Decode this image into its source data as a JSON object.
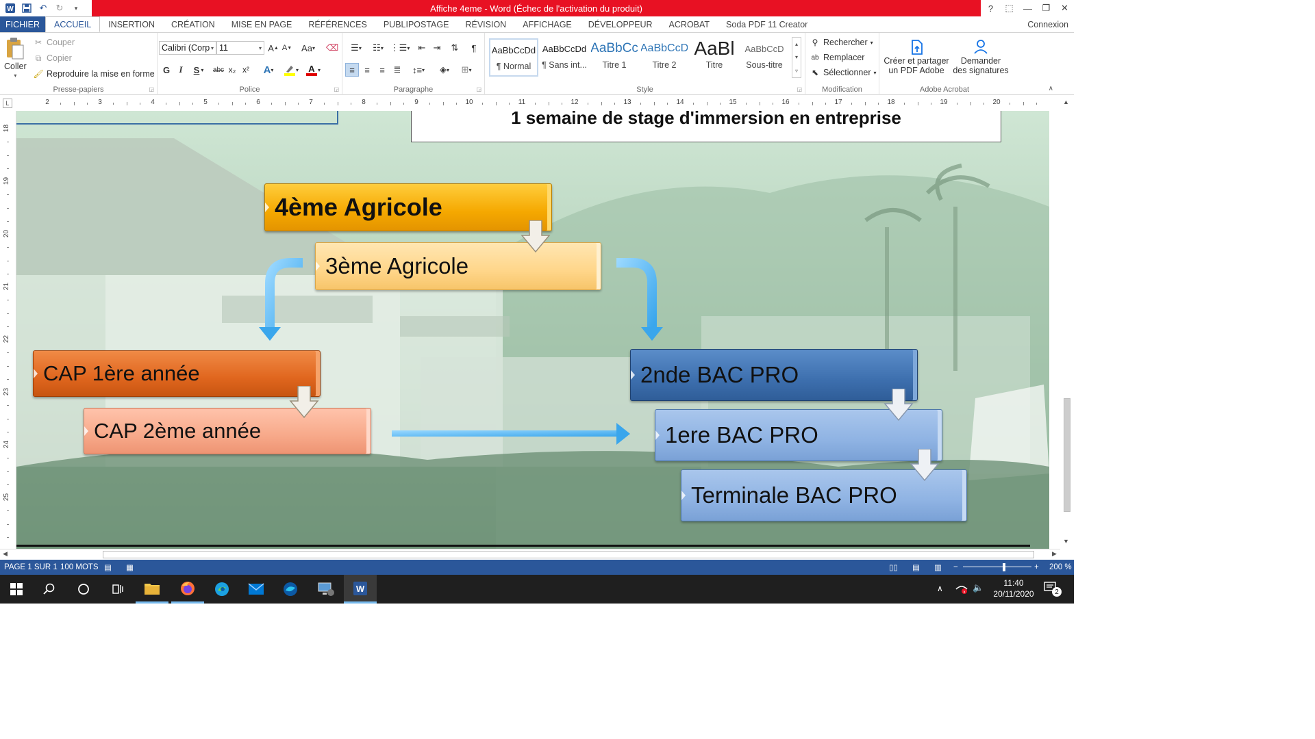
{
  "titlebar": {
    "title": "Affiche 4eme -  Word (Échec de l'activation du produit)",
    "help": "?",
    "ribbon_display": "⬚",
    "minimize": "—",
    "restore": "❐",
    "close": "✕"
  },
  "tabs": [
    {
      "label": "FICHIER"
    },
    {
      "label": "ACCUEIL"
    },
    {
      "label": "INSERTION"
    },
    {
      "label": "CRÉATION"
    },
    {
      "label": "MISE EN PAGE"
    },
    {
      "label": "RÉFÉRENCES"
    },
    {
      "label": "PUBLIPOSTAGE"
    },
    {
      "label": "RÉVISION"
    },
    {
      "label": "AFFICHAGE"
    },
    {
      "label": "DÉVELOPPEUR"
    },
    {
      "label": "ACROBAT"
    },
    {
      "label": "Soda PDF 11 Creator"
    }
  ],
  "connexion": "Connexion",
  "clipboard": {
    "paste": "Coller",
    "cut": "Couper",
    "copy": "Copier",
    "format_painter": "Reproduire la mise en forme",
    "label": "Presse-papiers"
  },
  "font": {
    "name": "Calibri (Corp",
    "size": "11",
    "label": "Police",
    "bold": "G",
    "italic": "I",
    "underline": "S",
    "strike": "abc",
    "sub": "x₂",
    "sup": "x²",
    "grow": "A",
    "shrink": "A",
    "case": "Aa"
  },
  "paragraph": {
    "label": "Paragraphe",
    "pilcrow": "¶"
  },
  "styles": {
    "label": "Style",
    "items": [
      {
        "preview": "AaBbCcDd",
        "name": "¶ Normal"
      },
      {
        "preview": "AaBbCcDd",
        "name": "¶ Sans int..."
      },
      {
        "preview": "AaBbCc",
        "name": "Titre 1"
      },
      {
        "preview": "AaBbCcD",
        "name": "Titre 2"
      },
      {
        "preview": "AaBl",
        "name": "Titre"
      },
      {
        "preview": "AaBbCcD",
        "name": "Sous-titre"
      }
    ]
  },
  "editing": {
    "label": "Modification",
    "find": "Rechercher",
    "replace": "Remplacer",
    "select": "Sélectionner"
  },
  "acrobat": {
    "label": "Adobe Acrobat",
    "create_line1": "Créer et partager",
    "create_line2": "un PDF Adobe",
    "sign_line1": "Demander",
    "sign_line2": "des signatures"
  },
  "ruler": {
    "h": [
      "2",
      "3",
      "4",
      "5",
      "6",
      "7",
      "8",
      "9",
      "10",
      "11",
      "12",
      "13",
      "14",
      "15",
      "16",
      "17",
      "18",
      "19",
      "20"
    ],
    "v": [
      "18",
      "19",
      "20",
      "21",
      "22",
      "23",
      "24",
      "25"
    ]
  },
  "document": {
    "banner": "1 semaine de stage d'immersion en entreprise",
    "boxes": {
      "quatrieme": "4ème Agricole",
      "troisieme": "3ème Agricole",
      "cap1": "CAP 1ère année",
      "cap2": "CAP 2ème année",
      "seconde": "2nde BAC PRO",
      "premiere": "1ere BAC PRO",
      "terminale": "Terminale BAC PRO"
    }
  },
  "status": {
    "page": "PAGE 1 SUR 1",
    "words": "100 MOTS",
    "zoom": "200 %"
  },
  "taskbar": {
    "time": "11:40",
    "date": "20/11/2020",
    "notifications": "2"
  },
  "colors": {
    "word_blue": "#2b579a",
    "title_red": "#e81123",
    "gold": "#f5a800",
    "orange": "#e0661e",
    "navy": "#3d6fae",
    "sky": "#8fb3e3",
    "arrow_blue": "#4fb4f0"
  }
}
